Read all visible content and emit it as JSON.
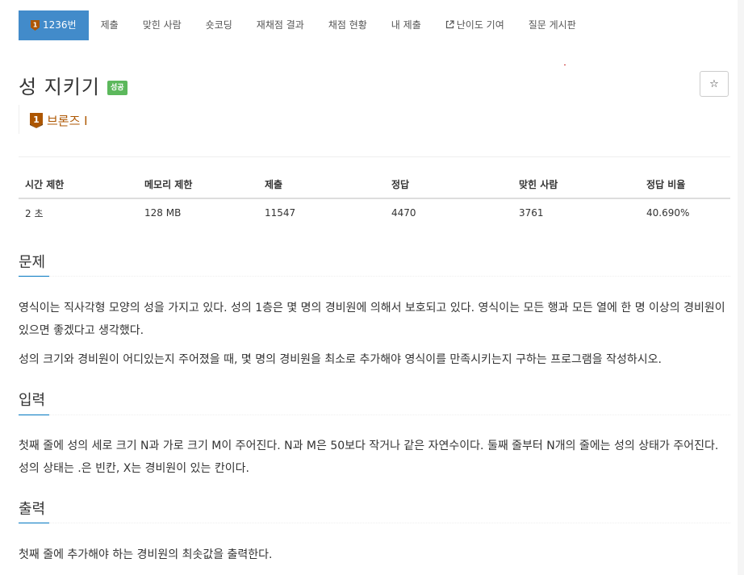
{
  "nav": {
    "problem_number": "1236번",
    "items": [
      "제출",
      "맞힌 사람",
      "숏코딩",
      "재채점 결과",
      "채점 현황",
      "내 제출",
      "난이도 기여",
      "질문 게시판"
    ]
  },
  "problem": {
    "title": "성 지키기",
    "result_label": "성공",
    "tier": "브론즈 I",
    "tier_digit": "1",
    "star": "☆"
  },
  "info_table": {
    "headers": [
      "시간 제한",
      "메모리 제한",
      "제출",
      "정답",
      "맞힌 사람",
      "정답 비율"
    ],
    "values": [
      "2 초",
      "128 MB",
      "11547",
      "4470",
      "3761",
      "40.690%"
    ]
  },
  "sections": {
    "description": {
      "title": "문제",
      "paragraphs": [
        "영식이는 직사각형 모양의 성을 가지고 있다. 성의 1층은 몇 명의 경비원에 의해서 보호되고 있다. 영식이는 모든 행과 모든 열에 한 명 이상의 경비원이 있으면 좋겠다고 생각했다.",
        "성의 크기와 경비원이 어디있는지 주어졌을 때, 몇 명의 경비원을 최소로 추가해야 영식이를 만족시키는지 구하는 프로그램을 작성하시오."
      ]
    },
    "input": {
      "title": "입력",
      "paragraph": "첫째 줄에 성의 세로 크기 N과 가로 크기 M이 주어진다. N과 M은 50보다 작거나 같은 자연수이다. 둘째 줄부터 N개의 줄에는 성의 상태가 주어진다. 성의 상태는 .은 빈칸, X는 경비원이 있는 칸이다."
    },
    "output": {
      "title": "출력",
      "paragraph": "첫째 줄에 추가해야 하는 경비원의 최솟값을 출력한다."
    }
  },
  "colors": {
    "accent": "#428bca",
    "success": "#5cb85c",
    "bronze": "#ad5600",
    "section_underline": "#0076c0"
  }
}
